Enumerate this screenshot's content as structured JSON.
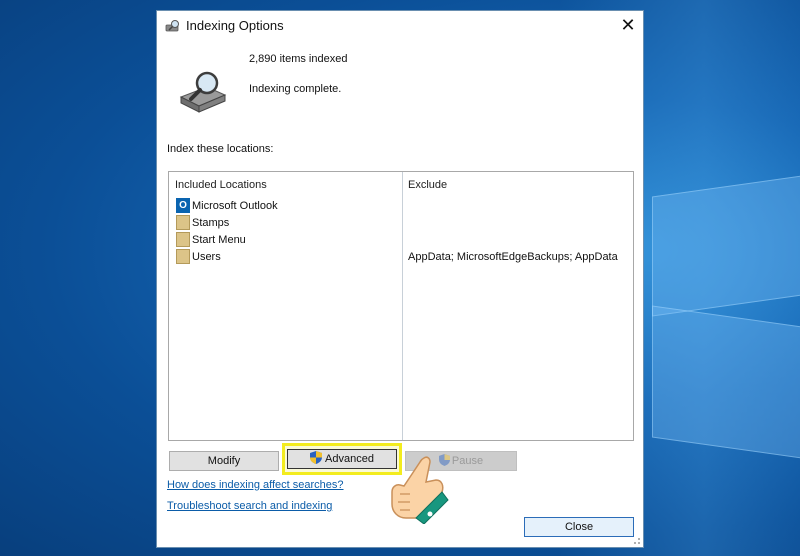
{
  "dialog": {
    "title": "Indexing Options",
    "close_glyph": "✕",
    "items_indexed": "2,890 items indexed",
    "status": "Indexing complete.",
    "section_label": "Index these locations:",
    "icons": {
      "title": "indexing-options-icon",
      "big": "hard-drive-magnifier-icon"
    }
  },
  "locations": {
    "headers": {
      "included": "Included Locations",
      "exclude": "Exclude"
    },
    "rows": [
      {
        "name": "Microsoft Outlook",
        "exclude": "",
        "icon": "outlook-icon"
      },
      {
        "name": "Stamps",
        "exclude": "",
        "icon": "folder-icon"
      },
      {
        "name": "Start Menu",
        "exclude": "",
        "icon": "folder-icon"
      },
      {
        "name": "Users",
        "exclude": "AppData; MicrosoftEdgeBackups; AppData",
        "icon": "folder-icon"
      }
    ]
  },
  "buttons": {
    "modify": "Modify",
    "advanced": "Advanced",
    "pause": "Pause",
    "close": "Close"
  },
  "links": {
    "how_indexing": "How does indexing affect searches?",
    "troubleshoot": "Troubleshoot search and indexing"
  },
  "colors": {
    "highlight": "#f3ec1e",
    "link": "#0b5ca8",
    "desktop": "#1565b2"
  }
}
